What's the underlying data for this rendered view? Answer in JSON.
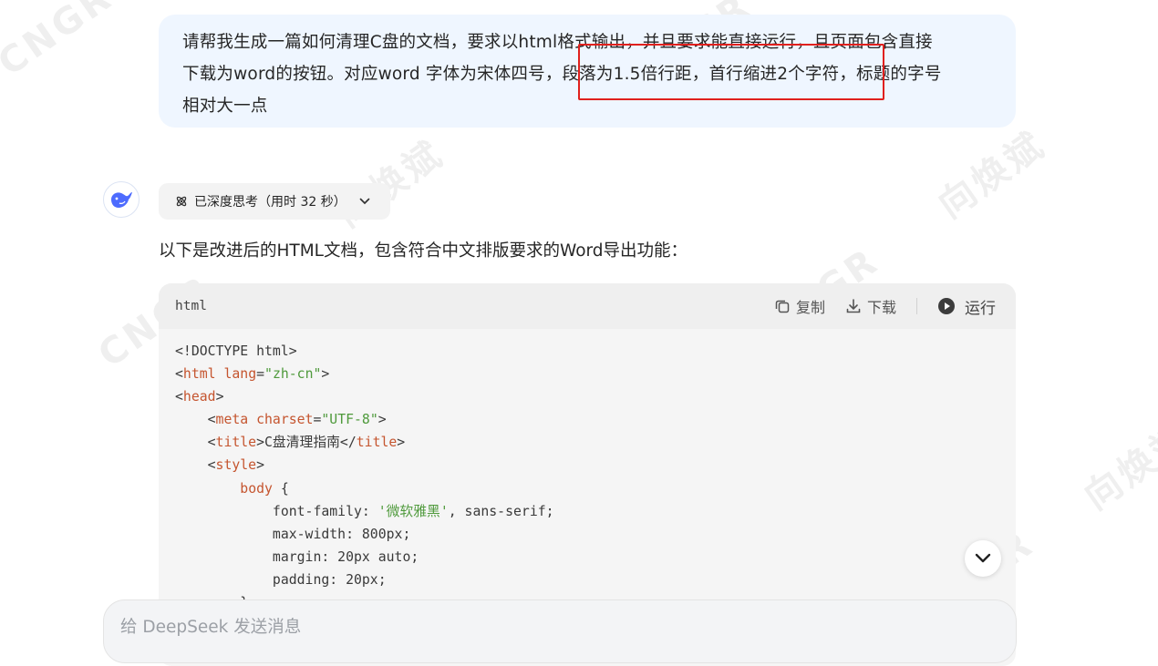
{
  "user_message": {
    "line1": "请帮我生成一篇如何清理C盘的文档，要求以html格式输出，并且要求能直接运行，且页面包含直接",
    "line2": "下载为word的按钮。对应word 字体为宋体四号，段落为1.5倍行距，首行缩进2个字符，标题的字号",
    "line3": "相对大一点"
  },
  "assistant": {
    "think_label": "已深度思考（用时 32 秒）",
    "intro_text": "以下是改进后的HTML文档，包含符合中文排版要求的Word导出功能："
  },
  "code_block": {
    "language": "html",
    "copy_label": "复制",
    "download_label": "下载",
    "run_label": "运行",
    "lines": {
      "l1": "<!DOCTYPE html>",
      "l2_tag": "html",
      "l2_attr": "lang",
      "l2_val": "\"zh-cn\"",
      "l3_tag": "head",
      "l4_tag": "meta",
      "l4_attr": "charset",
      "l4_val": "\"UTF-8\"",
      "l5_tag": "title",
      "l5_text": "C盘清理指南",
      "l6_tag": "style",
      "l7_sel": "body",
      "l8_prop": "font-family: ",
      "l8_val": "'微软雅黑'",
      "l8_rest": ", sans-serif;",
      "l9": "max-width: 800px;",
      "l10": "margin: 20px auto;",
      "l11": "padding: 20px;",
      "l12": "}"
    }
  },
  "input": {
    "placeholder": "给 DeepSeek 发送消息"
  },
  "watermarks": [
    "CNGR",
    "向焕斌"
  ],
  "colors": {
    "highlight_box": "#e0201d",
    "user_bubble_bg": "#eff6ff",
    "brand_blue": "#4d6bfe"
  }
}
